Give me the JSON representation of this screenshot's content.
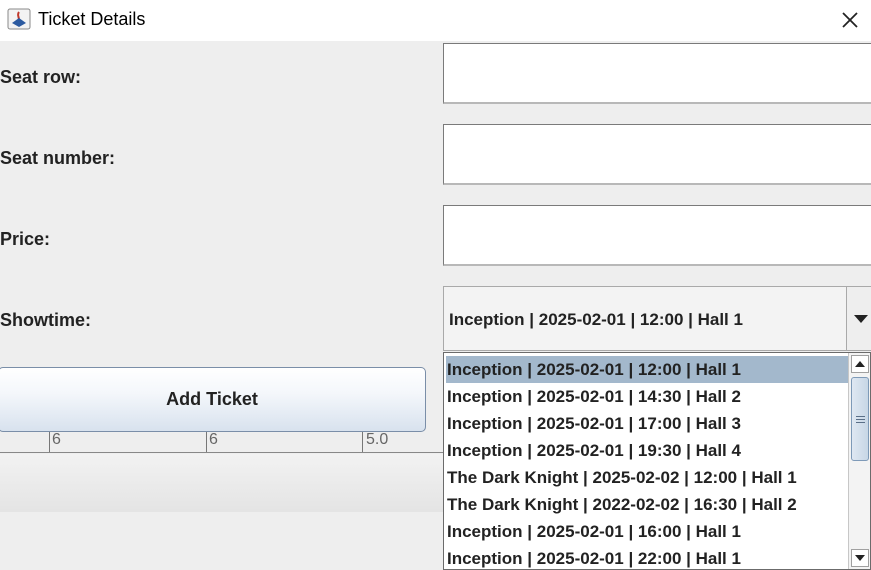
{
  "window": {
    "title": "Ticket Details",
    "icon": "java-app-icon",
    "close_icon": "close-icon"
  },
  "form": {
    "seat_row_label": "Seat row:",
    "seat_row_value": "",
    "seat_number_label": "Seat number:",
    "seat_number_value": "",
    "price_label": "Price:",
    "price_value": "",
    "showtime_label": "Showtime:",
    "showtime_selected": "Inception | 2025-02-01 | 12:00 | Hall 1"
  },
  "add_button": {
    "label": "Add Ticket"
  },
  "background_table": {
    "cells": [
      "6",
      "6",
      "5.0"
    ]
  },
  "showtime_options": [
    "Inception | 2025-02-01 | 12:00 | Hall 1",
    "Inception | 2025-02-01 | 14:30 | Hall 2",
    "Inception | 2025-02-01 | 17:00 | Hall 3",
    "Inception | 2025-02-01 | 19:30 | Hall 4",
    "The Dark Knight | 2025-02-02 | 12:00 | Hall 1",
    "The Dark Knight | 2022-02-02 | 16:30 | Hall 2",
    "Inception | 2025-02-01 | 16:00 | Hall 1",
    "Inception | 2025-02-01 | 22:00 | Hall 1"
  ],
  "colors": {
    "selected_option_bg": "#a3b8cc",
    "window_bg": "#eeeeee"
  }
}
